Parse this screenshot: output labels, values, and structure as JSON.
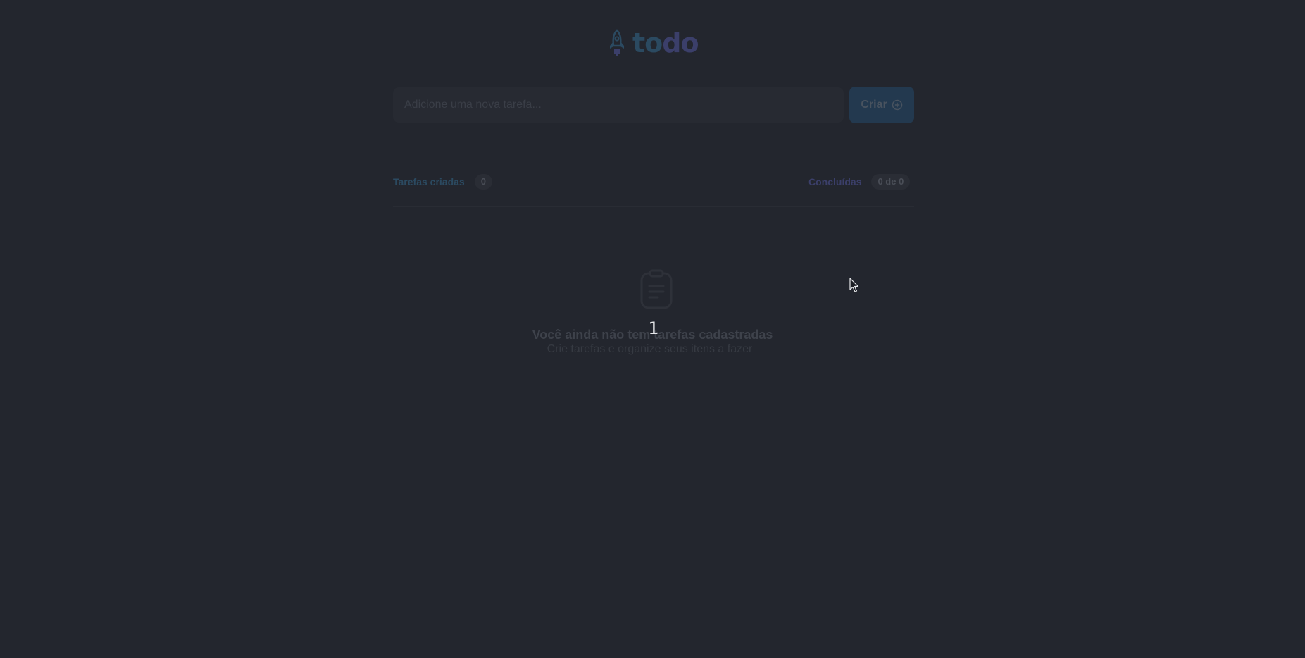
{
  "header": {
    "logo_text_part1": "to",
    "logo_text_part2": "do",
    "logo_icon": "rocket-icon"
  },
  "new_task": {
    "placeholder": "Adicione uma nova tarefa...",
    "value": "",
    "create_label": "Criar",
    "create_icon": "plus-circle-icon"
  },
  "counters": {
    "created_label": "Tarefas criadas",
    "created_count": "0",
    "done_label": "Concluídas",
    "done_count": "0 de 0"
  },
  "empty_state": {
    "icon": "clipboard-icon",
    "title": "Você ainda não tem tarefas cadastradas",
    "subtitle": "Crie tarefas e organize seus itens a fazer",
    "overlay_number": "1"
  },
  "colors": {
    "background": "#23262e",
    "blue": "#2b4a61",
    "purple": "#3b3f6a",
    "button": "#23394f"
  }
}
